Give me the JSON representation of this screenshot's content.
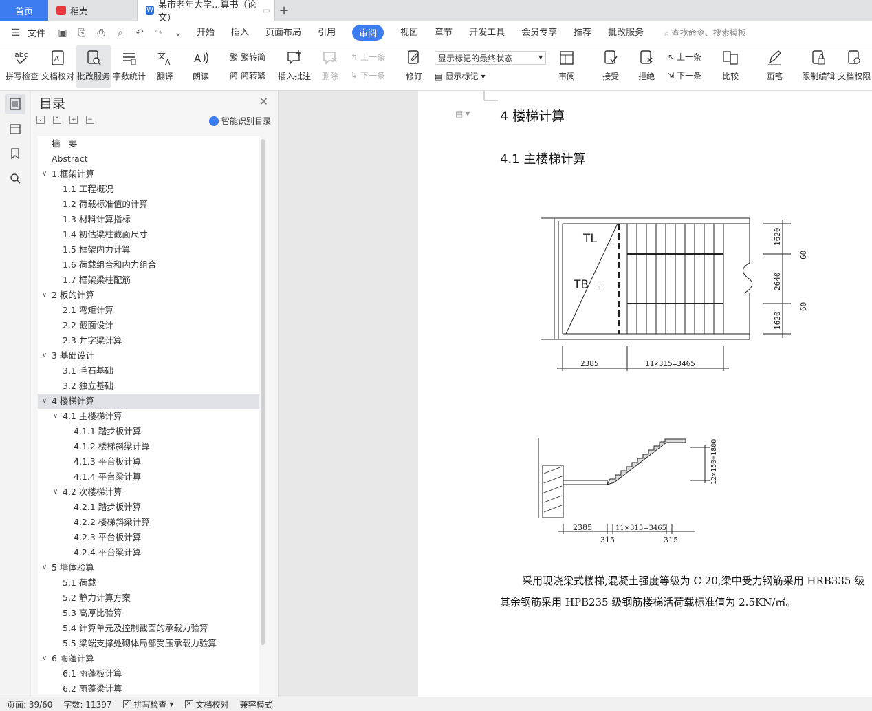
{
  "tabs": {
    "home": "首页",
    "t1": "稻壳",
    "t2": "某市老年大学...算书（论文）"
  },
  "menu": {
    "file": "文件",
    "items": [
      "开始",
      "插入",
      "页面布局",
      "引用",
      "审阅",
      "视图",
      "章节",
      "开发工具",
      "会员专享",
      "推荐",
      "批改服务"
    ],
    "active_index": 4,
    "search_placeholder": "查找命令、搜索模板"
  },
  "ribbon": {
    "spellcheck": "拼写检查",
    "doc_check": "文档校对",
    "correction": "批改服务",
    "word_count": "字数统计",
    "translate": "翻译",
    "read_aloud": "朗读",
    "to_trad": "繁转简",
    "to_simp": "简转繁",
    "insert_comment": "插入批注",
    "delete": "删除",
    "prev_comment": "上一条",
    "next_comment": "下一条",
    "revise": "修订",
    "show_state": "显示标记的最终状态",
    "show_marks": "显示标记",
    "review": "审阅",
    "accept": "接受",
    "reject": "拒绝",
    "prev_change": "上一条",
    "next_change": "下一条",
    "compare": "比较",
    "pen": "画笔",
    "restrict": "限制编辑",
    "permission": "文档权限"
  },
  "toc": {
    "title": "目录",
    "smart": "智能识别目录",
    "selected_index": 17,
    "items": [
      {
        "label": "摘　要",
        "level": 0,
        "chev": false
      },
      {
        "label": "Abstract",
        "level": 0,
        "chev": false
      },
      {
        "label": "1.框架计算",
        "level": 0,
        "chev": true
      },
      {
        "label": "1.1 工程概况",
        "level": 1,
        "chev": false
      },
      {
        "label": "1.2 荷载标准值的计算",
        "level": 1,
        "chev": false
      },
      {
        "label": "1.3 材料计算指标",
        "level": 1,
        "chev": false
      },
      {
        "label": "1.4 初估梁柱截面尺寸",
        "level": 1,
        "chev": false
      },
      {
        "label": "1.5 框架内力计算",
        "level": 1,
        "chev": false
      },
      {
        "label": "1.6 荷载组合和内力组合",
        "level": 1,
        "chev": false
      },
      {
        "label": "1.7 框架梁柱配筋",
        "level": 1,
        "chev": false
      },
      {
        "label": "2 板的计算",
        "level": 0,
        "chev": true
      },
      {
        "label": "2.1 弯矩计算",
        "level": 1,
        "chev": false
      },
      {
        "label": "2.2 截面设计",
        "level": 1,
        "chev": false
      },
      {
        "label": "2.3 井字梁计算",
        "level": 1,
        "chev": false
      },
      {
        "label": "3 基础设计",
        "level": 0,
        "chev": true
      },
      {
        "label": "3.1  毛石基础",
        "level": 1,
        "chev": false
      },
      {
        "label": "3.2 独立基础",
        "level": 1,
        "chev": false
      },
      {
        "label": "4 楼梯计算",
        "level": 0,
        "chev": true
      },
      {
        "label": "4.1 主楼梯计算",
        "level": 1,
        "chev": true
      },
      {
        "label": "4.1.1 踏步板计算",
        "level": 2,
        "chev": false
      },
      {
        "label": "4.1.2 楼梯斜梁计算",
        "level": 2,
        "chev": false
      },
      {
        "label": "4.1.3 平台板计算",
        "level": 2,
        "chev": false
      },
      {
        "label": "4.1.4 平台梁计算",
        "level": 2,
        "chev": false
      },
      {
        "label": "4.2 次楼梯计算",
        "level": 1,
        "chev": true
      },
      {
        "label": "4.2.1 踏步板计算",
        "level": 2,
        "chev": false
      },
      {
        "label": "4.2.2 楼梯斜梁计算",
        "level": 2,
        "chev": false
      },
      {
        "label": "4.2.3 平台板计算",
        "level": 2,
        "chev": false
      },
      {
        "label": "4.2.4 平台梁计算",
        "level": 2,
        "chev": false
      },
      {
        "label": "5 墙体验算",
        "level": 0,
        "chev": true
      },
      {
        "label": "5.1 荷载",
        "level": 1,
        "chev": false
      },
      {
        "label": "5.2 静力计算方案",
        "level": 1,
        "chev": false
      },
      {
        "label": "5.3 高厚比验算",
        "level": 1,
        "chev": false
      },
      {
        "label": "5.4 计算单元及控制截面的承载力验算",
        "level": 1,
        "chev": false
      },
      {
        "label": "5.5 梁端支撑处砌体局部受压承载力验算",
        "level": 1,
        "chev": false
      },
      {
        "label": "6 雨蓬计算",
        "level": 0,
        "chev": true
      },
      {
        "label": "6.1 雨蓬板计算",
        "level": 1,
        "chev": false
      },
      {
        "label": "6.2 雨蓬梁计算",
        "level": 1,
        "chev": false
      }
    ]
  },
  "document": {
    "heading1": "4 楼梯计算",
    "heading2": "4.1 主楼梯计算",
    "plan_labels": {
      "tl": "TL",
      "tl_sub": "1",
      "tb": "TB",
      "tb_sub": "1",
      "d1": "1620",
      "d2": "2640",
      "d3": "1620",
      "g1": "60",
      "g2": "60",
      "w1": "2385",
      "w2": "11×315=3465"
    },
    "section_labels": {
      "h": "12×150=1800",
      "w1": "2385",
      "w2": "11×315=3465",
      "s1": "315",
      "s2": "315"
    },
    "para1": "采用现浇梁式楼梯,混凝土强度等级为 C 20,梁中受力钢筋采用 HRB335 级",
    "para2": "其余钢筋采用 HPB235 级钢筋楼梯活荷载标准值为 2.5KN/㎡。"
  },
  "status": {
    "page": "页面: 39/60",
    "words": "字数: 11397",
    "spell": "拼写检查",
    "check": "文档校对",
    "compat": "兼容模式"
  },
  "colors": {
    "accent": "#3d7bf0",
    "selected_row": "#dfe1e6"
  }
}
